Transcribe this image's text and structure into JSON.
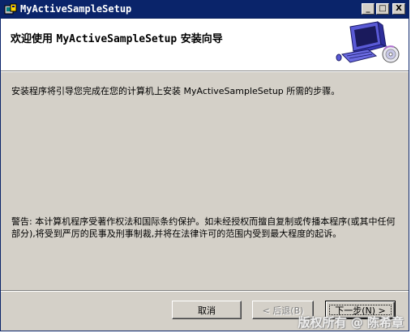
{
  "window": {
    "title": "MyActiveSampleSetup",
    "minimize_symbol": "_",
    "maximize_symbol": "□",
    "close_symbol": "X"
  },
  "banner": {
    "title_prefix": "欢迎使用 ",
    "title_product": "MyActiveSampleSetup",
    "title_suffix": " 安装向导"
  },
  "intro_text": "安装程序将引导您完成在您的计算机上安装 MyActiveSampleSetup 所需的步骤。",
  "warning_text": "警告: 本计算机程序受著作权法和国际条约保护。如未经授权而擅自复制或传播本程序(或其中任何部分),将受到严厉的民事及刑事制裁,并将在法律许可的范围内受到最大程度的起诉。",
  "buttons": {
    "cancel": "取消",
    "back": "< 后退(B)",
    "next": "下一步(N) >"
  },
  "watermark": "版权所有 @ 陈希章",
  "icons": {
    "title_icon": "setup-icon",
    "banner_art": "computer-cd-icon"
  },
  "colors": {
    "titlebar": "#0a246a",
    "dialog": "#d4d0c8",
    "banner": "#ffffff"
  }
}
